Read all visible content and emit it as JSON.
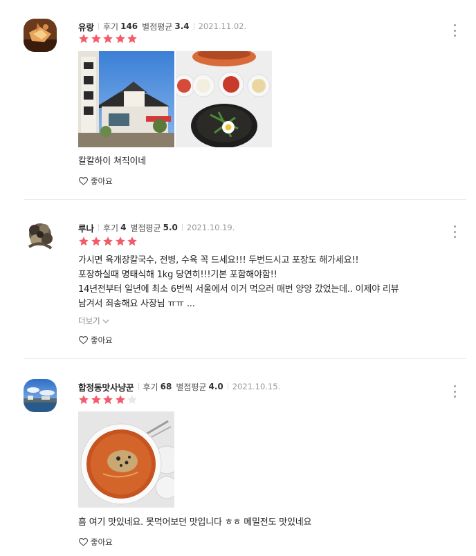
{
  "reviews": [
    {
      "author": "유랑",
      "review_label": "후기",
      "review_count": "146",
      "avg_label": "별점평균",
      "avg_score": "3.4",
      "date": "2021.11.02.",
      "rating": 5,
      "text_lines": [
        "칼칼하이 쳐직이네"
      ],
      "like_label": "좋아요"
    },
    {
      "author": "루나",
      "review_label": "후기",
      "review_count": "4",
      "avg_label": "별점평균",
      "avg_score": "5.0",
      "date": "2021.10.19.",
      "rating": 5,
      "text_lines": [
        "가시면 육개장칼국수, 전병, 수육 꼭 드세요!!! 두번드시고 포장도 해가세요!!",
        "포장하실때 명태식해 1kg 당연히!!!기본 포함해야함!!",
        "14년전부터 일년에 최소 6번씩 서울에서 이거 먹으러 매번 양양 갔었는데.. 이제야 리뷰",
        "남겨서 죄송해요 사장님 ㅠㅠ ..."
      ],
      "more_label": "더보기",
      "like_label": "좋아요"
    },
    {
      "author": "합정동맛사냥꾼",
      "review_label": "후기",
      "review_count": "68",
      "avg_label": "별점평균",
      "avg_score": "4.0",
      "date": "2021.10.15.",
      "rating": 4,
      "text_lines": [
        "흠 여기 맛있네요. 못먹어보던 맛입니다 ㅎㅎ 메밀전도 맛있네요"
      ],
      "like_label": "좋아요"
    }
  ],
  "colors": {
    "star_on": "#f25c6a",
    "star_off": "#e8e8e8"
  },
  "icons": {
    "star": "star-icon",
    "more": "more-vertical-icon",
    "heart": "heart-outline-icon",
    "chevron": "chevron-down-icon"
  }
}
